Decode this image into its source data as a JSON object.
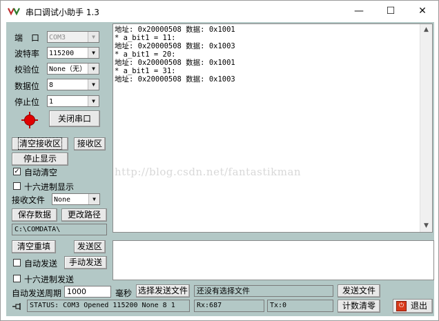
{
  "window": {
    "title": "串口调试小助手 1.3",
    "minimize": "—",
    "maximize": "☐",
    "close": "✕"
  },
  "settings": {
    "port_label": "端　口",
    "port_value": "COM3",
    "baud_label": "波特率",
    "baud_value": "115200",
    "parity_label": "校验位",
    "parity_value": "None（无）",
    "databits_label": "数据位",
    "databits_value": "8",
    "stopbits_label": "停止位",
    "stopbits_value": "1",
    "open_close_button": "关闭串口"
  },
  "receive": {
    "clear_button": "清空接收区",
    "area_button": "接收区",
    "stop_display_button": "停止显示",
    "auto_clear_label": "自动清空",
    "auto_clear_checked": true,
    "hex_display_label": "十六进制显示",
    "hex_display_checked": false,
    "file_label": "接收文件",
    "file_value": "None",
    "save_button": "保存数据",
    "change_path_button": "更改路径",
    "path": "C:\\COMDATA\\",
    "lines": [
      "地址: 0x20000508 数据: 0x1001",
      "* a_bit1 = 11:",
      "地址: 0x20000508 数据: 0x1003",
      "* a_bit1 = 20:",
      "地址: 0x20000508 数据: 0x1001",
      "* a_bit1 = 31:",
      "地址: 0x20000508 数据: 0x1003"
    ],
    "watermark": "http://blog.csdn.net/fantastikman"
  },
  "send": {
    "clear_resend_button": "清空重填",
    "area_button": "发送区",
    "auto_send_label": "自动发送",
    "auto_send_checked": false,
    "manual_send_button": "手动发送",
    "hex_send_label": "十六进制发送",
    "hex_send_checked": false,
    "period_label": "自动发送周期",
    "period_value": "1000",
    "ms_label": "毫秒",
    "choose_file_button": "选择发送文件",
    "file_status": "还没有选择文件",
    "send_file_button": "发送文件"
  },
  "statusbar": {
    "status": "STATUS: COM3 Opened 115200 None  8 1",
    "rx": "Rx:687",
    "tx": "Tx:0",
    "reset_count_button": "计数清零",
    "exit_button": "退出"
  },
  "colors": {
    "client_bg": "#b3c8c6",
    "lamp": "#e00000"
  }
}
